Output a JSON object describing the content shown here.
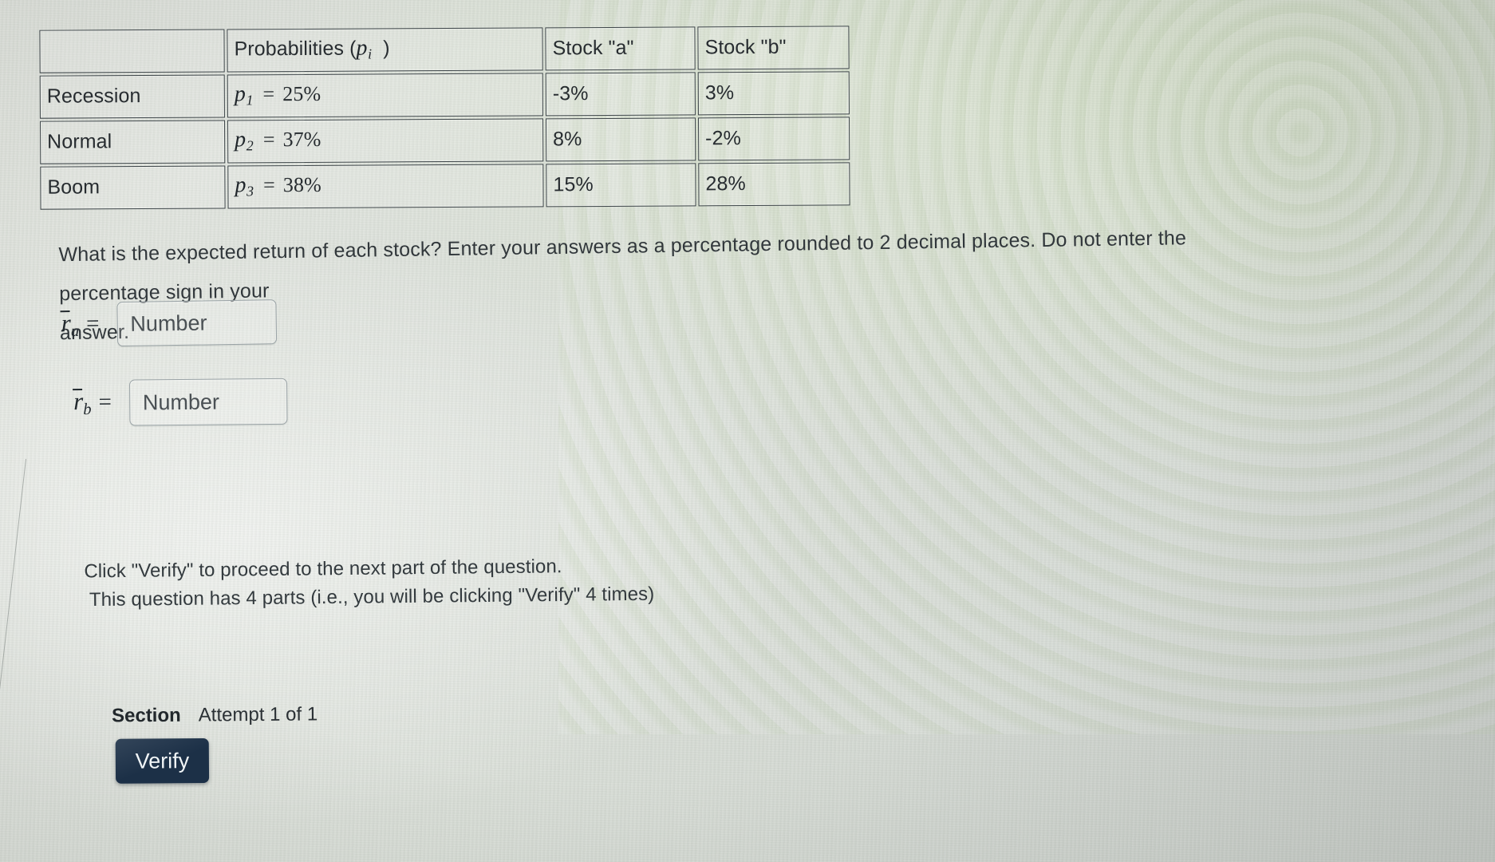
{
  "table": {
    "headers": [
      "",
      "Probabilities ( p_i )",
      "Stock \"a\"",
      "Stock \"b\""
    ],
    "header_prob_text": "Probabilities (",
    "header_prob_sym": "p",
    "header_prob_sub": "i",
    "header_prob_close": ")",
    "header_stock_a": "Stock \"a\"",
    "header_stock_b": "Stock \"b\"",
    "rows": [
      {
        "state": "Recession",
        "prob_sym": "p",
        "prob_sub": "1",
        "prob_eq": "=",
        "prob_value": "25%",
        "stock_a": "-3%",
        "stock_b": "3%"
      },
      {
        "state": "Normal",
        "prob_sym": "p",
        "prob_sub": "2",
        "prob_eq": "=",
        "prob_value": "37%",
        "stock_a": "8%",
        "stock_b": "-2%"
      },
      {
        "state": "Boom",
        "prob_sym": "p",
        "prob_sub": "3",
        "prob_eq": "=",
        "prob_value": "38%",
        "stock_a": "15%",
        "stock_b": "28%"
      }
    ]
  },
  "question": {
    "line1": "What is the expected return of each stock? Enter your answers as a percentage rounded to 2 decimal places.  Do not enter the percentage sign in your",
    "line2": "answer."
  },
  "answers": {
    "a": {
      "label_sym": "r",
      "label_sub": "a",
      "label_eq": "=",
      "placeholder": "Number",
      "value": ""
    },
    "b": {
      "label_sym": "r",
      "label_sub": "b",
      "label_eq": "=",
      "placeholder": "Number",
      "value": ""
    }
  },
  "verify": {
    "note1": "Click \"Verify\" to proceed to the next part of the question.",
    "note2": "This question has 4 parts (i.e., you will be clicking \"Verify\" 4 times)",
    "section_label": "Section",
    "attempt_label": "Attempt 1 of 1",
    "button_label": "Verify"
  },
  "colors": {
    "button_bg": "#1c3047",
    "button_text": "#f1f5f7",
    "text": "#2b3034",
    "table_border": "#3d4548",
    "background": "#d8dcd6"
  }
}
